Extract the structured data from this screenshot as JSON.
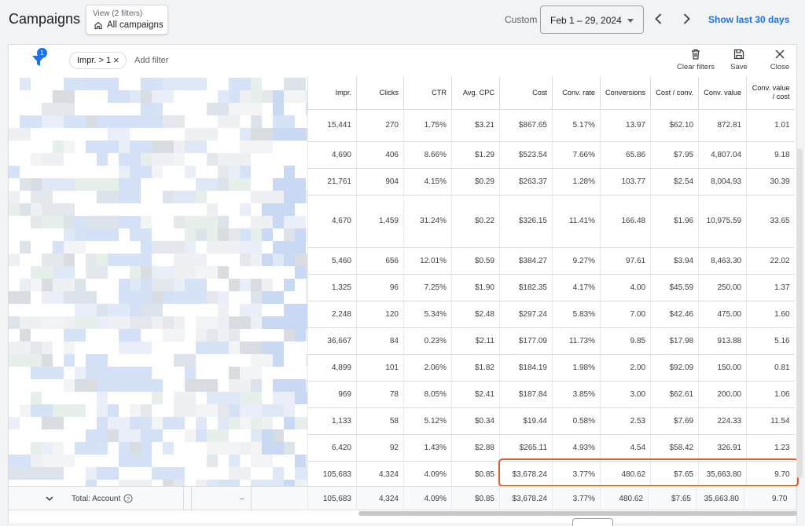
{
  "header": {
    "title": "Campaigns",
    "view_sub": "View (2 filters)",
    "view_main": "All campaigns",
    "custom_label": "Custom",
    "date_range": "Feb 1 – 29, 2024",
    "show_last": "Show last 30 days"
  },
  "filterbar": {
    "badge_count": "1",
    "chip_label": "Impr. > 1",
    "chip_close": "×",
    "add_filter": "Add filter",
    "clear_filters": "Clear filters",
    "save": "Save",
    "close": "Close"
  },
  "table": {
    "columns": [
      "Impr.",
      "Clicks",
      "CTR",
      "Avg. CPC",
      "Cost",
      "Conv. rate",
      "Conversions",
      "Cost / conv.",
      "Conv. value",
      "Conv. value / cost"
    ],
    "rows": [
      [
        "15,441",
        "270",
        "1.75%",
        "$3.21",
        "$867.65",
        "5.17%",
        "13.97",
        "$62.10",
        "872.81",
        "1.01"
      ],
      [
        "4,690",
        "406",
        "8.66%",
        "$1.29",
        "$523.54",
        "7.66%",
        "65.86",
        "$7.95",
        "4,807.04",
        "9.18"
      ],
      [
        "21,761",
        "904",
        "4.15%",
        "$0.29",
        "$263.37",
        "1.28%",
        "103.77",
        "$2.54",
        "8,004.93",
        "30.39"
      ],
      [
        "4,670",
        "1,459",
        "31.24%",
        "$0.22",
        "$326.15",
        "11.41%",
        "166.48",
        "$1.96",
        "10,975.59",
        "33.65"
      ],
      [
        "5,460",
        "656",
        "12.01%",
        "$0.59",
        "$384.27",
        "9.27%",
        "97.61",
        "$3.94",
        "8,463.30",
        "22.02"
      ],
      [
        "1,325",
        "96",
        "7.25%",
        "$1.90",
        "$182.35",
        "4.17%",
        "4.00",
        "$45.59",
        "250.00",
        "1.37"
      ],
      [
        "2,248",
        "120",
        "5.34%",
        "$2.48",
        "$297.24",
        "5.83%",
        "7.00",
        "$42.46",
        "475.00",
        "1.60"
      ],
      [
        "36,667",
        "84",
        "0.23%",
        "$2.11",
        "$177.09",
        "11.73%",
        "9.85",
        "$17.98",
        "913.88",
        "5.16"
      ],
      [
        "4,899",
        "101",
        "2.06%",
        "$1.82",
        "$184.19",
        "1.98%",
        "2.00",
        "$92.09",
        "150.00",
        "0.81"
      ],
      [
        "969",
        "78",
        "8.05%",
        "$2.41",
        "$187.84",
        "3.85%",
        "3.00",
        "$62.61",
        "200.00",
        "1.06"
      ],
      [
        "1,133",
        "58",
        "5.12%",
        "$0.34",
        "$19.44",
        "0.58%",
        "2.53",
        "$7.69",
        "224.33",
        "11.54"
      ],
      [
        "6,420",
        "92",
        "1.43%",
        "$2.88",
        "$265.11",
        "4.93%",
        "4.54",
        "$58.42",
        "326.91",
        "1.23"
      ],
      [
        "105,683",
        "4,324",
        "4.09%",
        "$0.85",
        "$3,678.24",
        "3.77%",
        "480.62",
        "$7.65",
        "35,663.80",
        "9.70"
      ]
    ]
  },
  "total": {
    "label": "Total: Account",
    "dash": "–",
    "values": [
      "105,683",
      "4,324",
      "4.09%",
      "$0.85",
      "$3,678.24",
      "3.77%",
      "480.62",
      "$7.65",
      "35,663.80",
      "9.70"
    ]
  },
  "colors": {
    "accent": "#1a73e8",
    "highlight": "#e8562a"
  }
}
